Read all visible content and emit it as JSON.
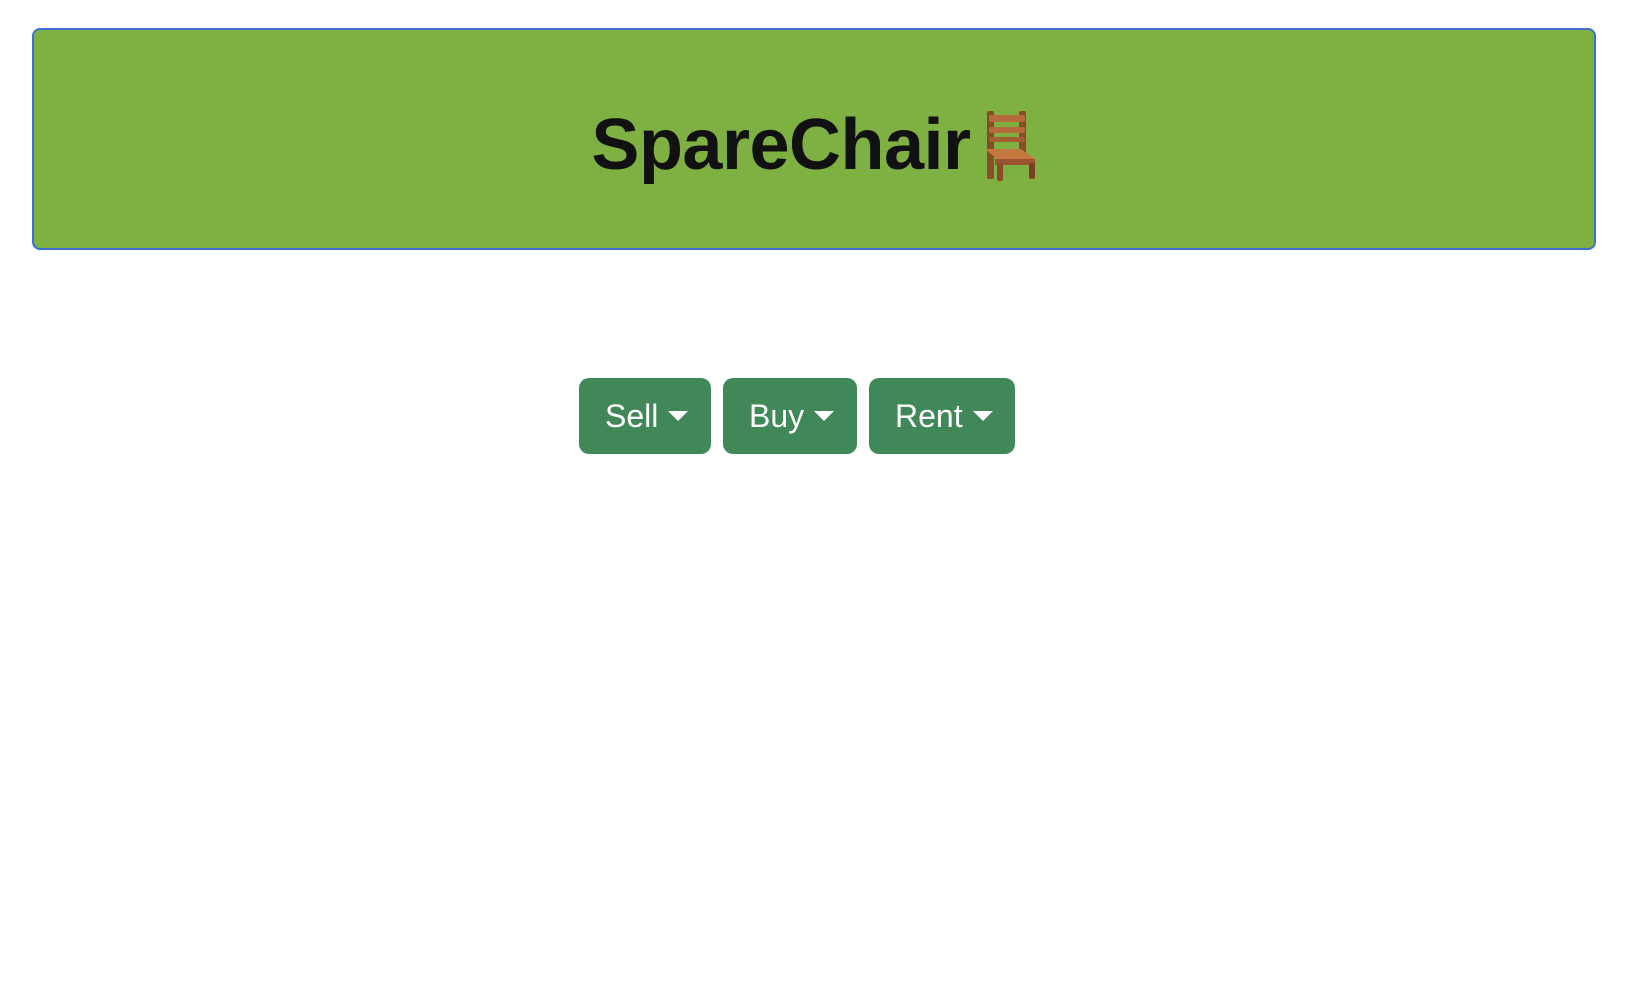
{
  "header": {
    "title": "SpareChair",
    "icon": "chair-icon",
    "background_color": "#7fb142",
    "border_color": "#3d6fd6"
  },
  "menu": {
    "button_color": "#418859",
    "items": [
      {
        "label": "Sell",
        "icon": "caret-down-icon"
      },
      {
        "label": "Buy",
        "icon": "caret-down-icon"
      },
      {
        "label": "Rent",
        "icon": "caret-down-icon"
      }
    ]
  }
}
